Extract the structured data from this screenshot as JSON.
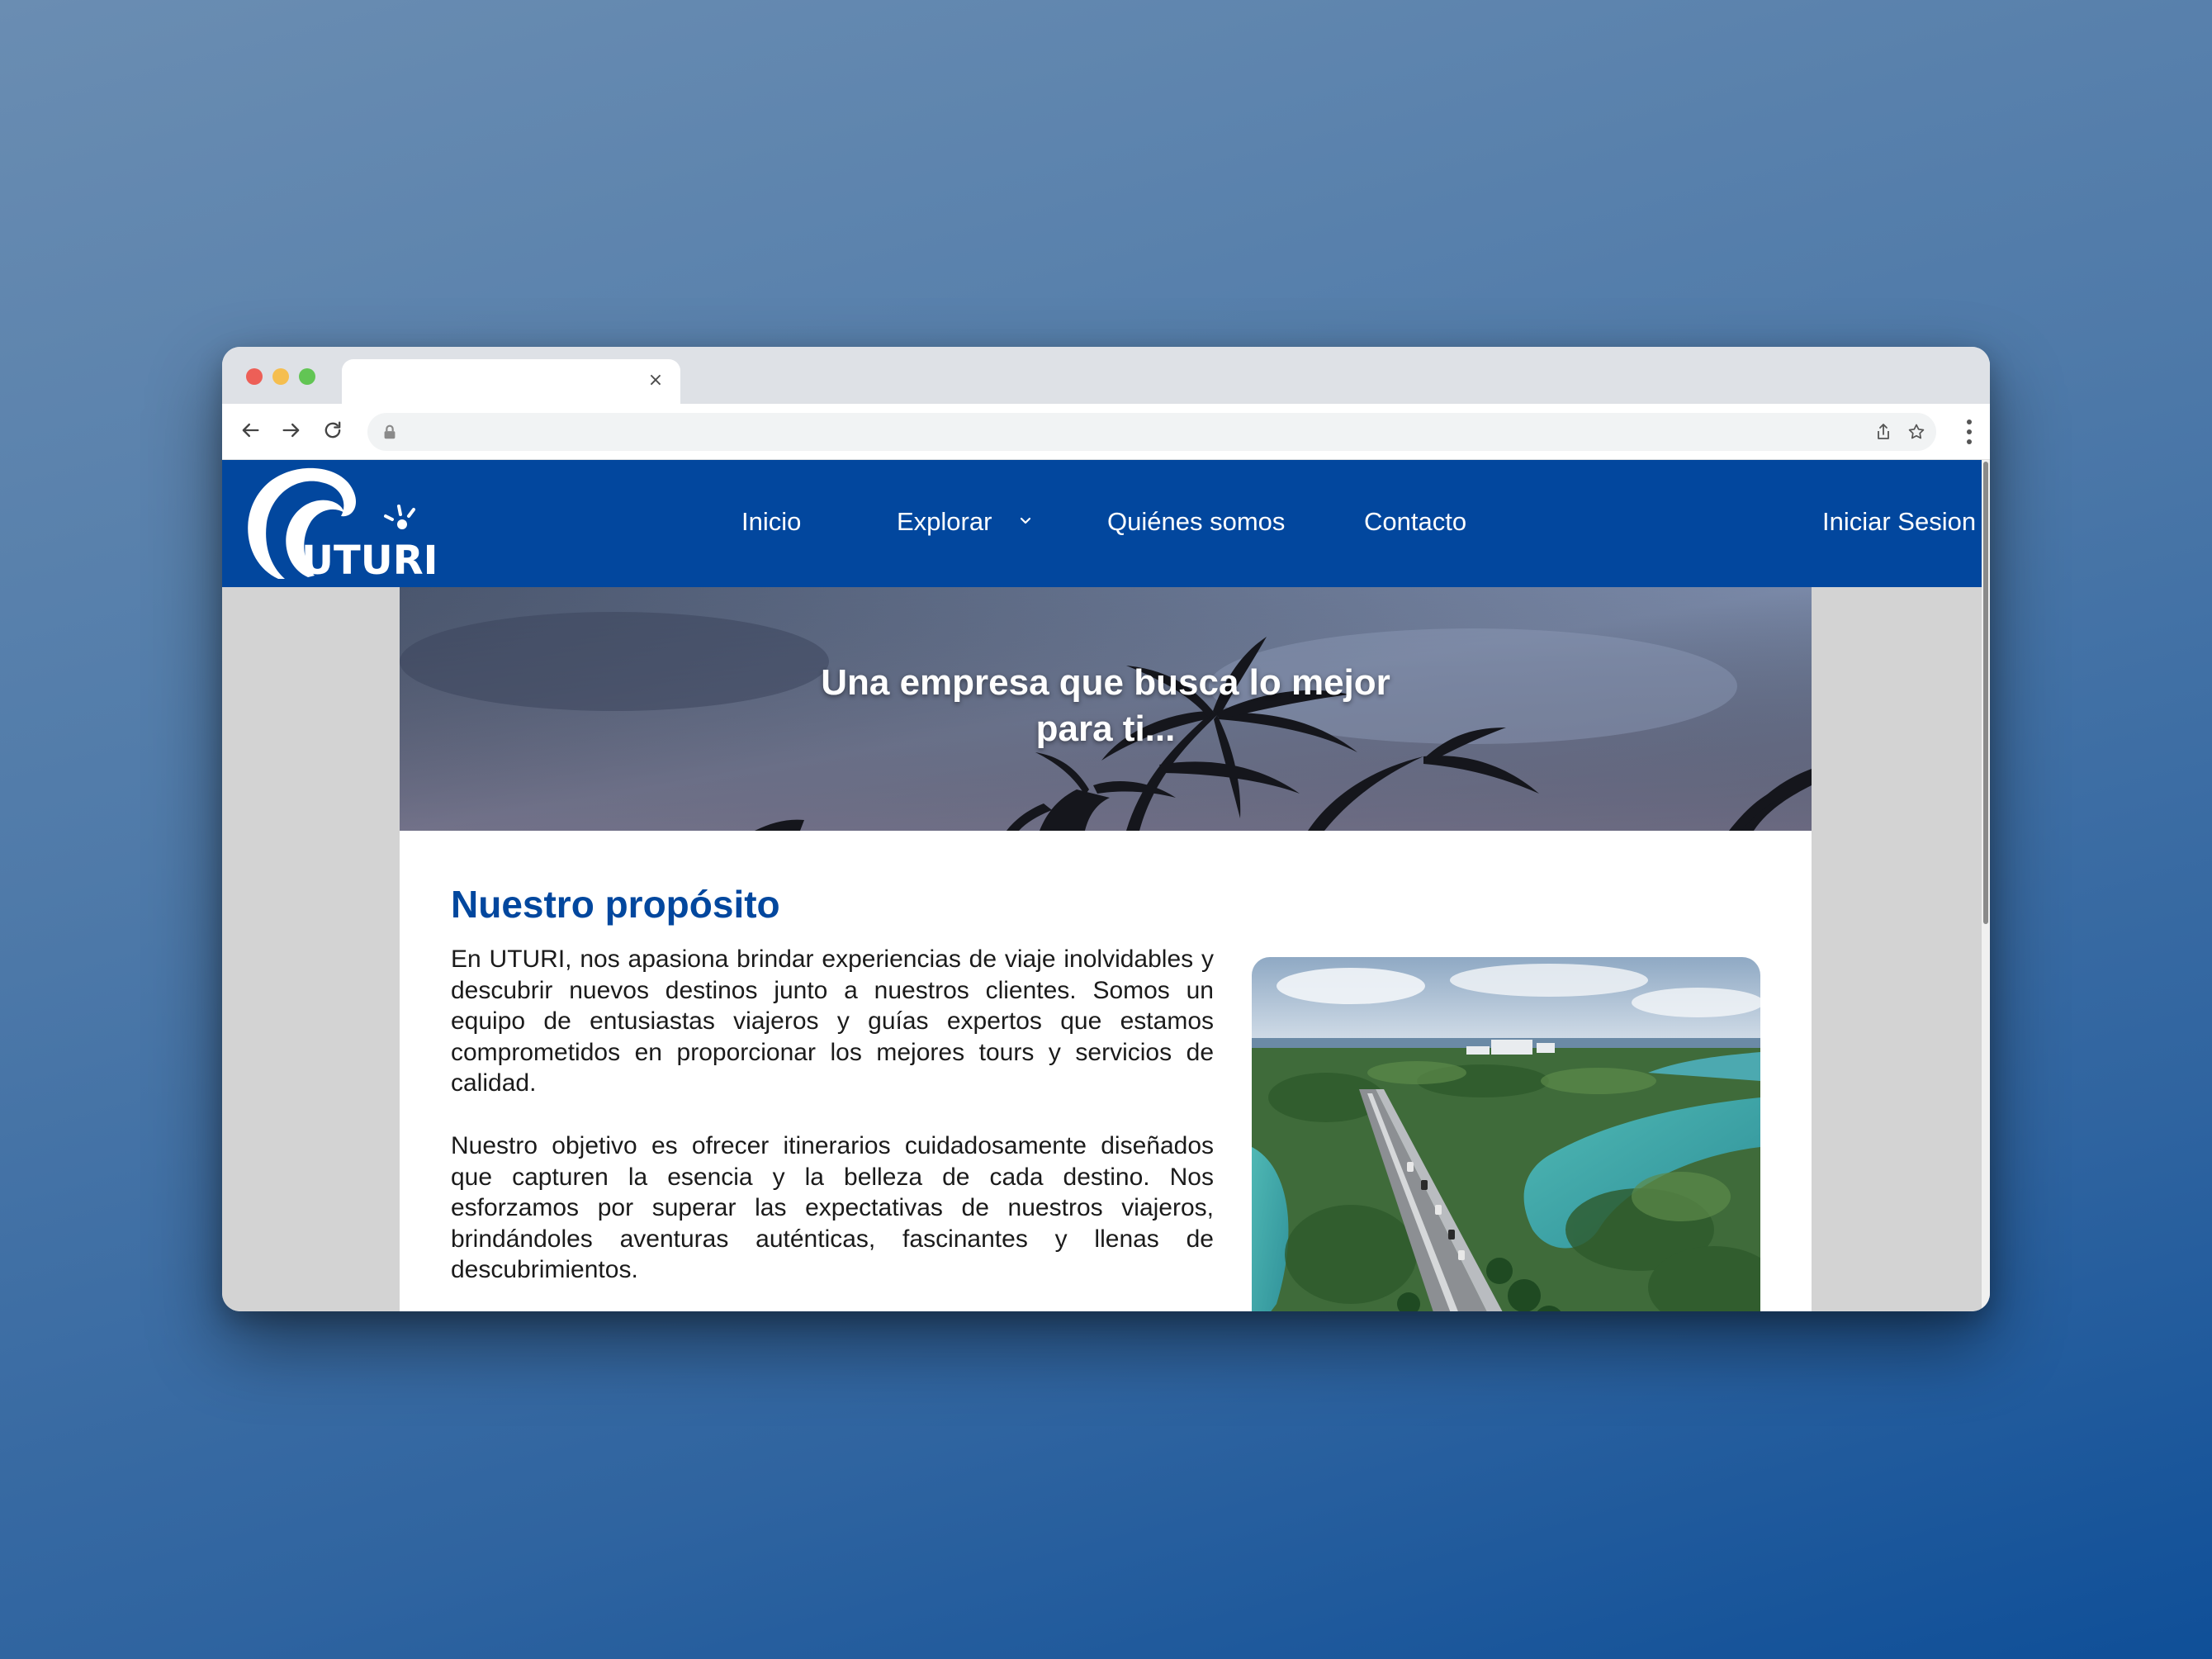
{
  "browser": {
    "tab_close_glyph": "×",
    "icons": [
      "back-arrow-icon",
      "forward-arrow-icon",
      "reload-icon",
      "lock-icon",
      "share-icon",
      "bookmark-star-icon",
      "more-vert-icon"
    ]
  },
  "site": {
    "logo_text": "UTURI",
    "nav": {
      "inicio": "Inicio",
      "explorar": "Explorar",
      "quienes": "Quiénes somos",
      "contacto": "Contacto",
      "login": "Iniciar Sesion"
    },
    "colors": {
      "brand_blue": "#02479e",
      "page_gray": "#d3d3d3"
    }
  },
  "hero": {
    "title_line1": "Una empresa que busca lo mejor",
    "title_line2": "para ti..."
  },
  "about": {
    "heading": "Nuestro propósito",
    "paragraph1": "En UTURI, nos apasiona brindar experiencias de viaje inolvidables y descubrir nuevos destinos junto a nuestros clientes. Somos un equipo de entusiastas viajeros y guías expertos que estamos comprometidos en proporcionar los mejores tours y servicios de calidad.",
    "paragraph2": "Nuestro objetivo es ofrecer itinerarios cuidadosamente diseñados que capturen la esencia y la belleza de cada destino. Nos esforzamos por superar las expectativas de nuestros viajeros, brindándoles aventuras auténticas, fascinantes y llenas de descubrimientos."
  }
}
